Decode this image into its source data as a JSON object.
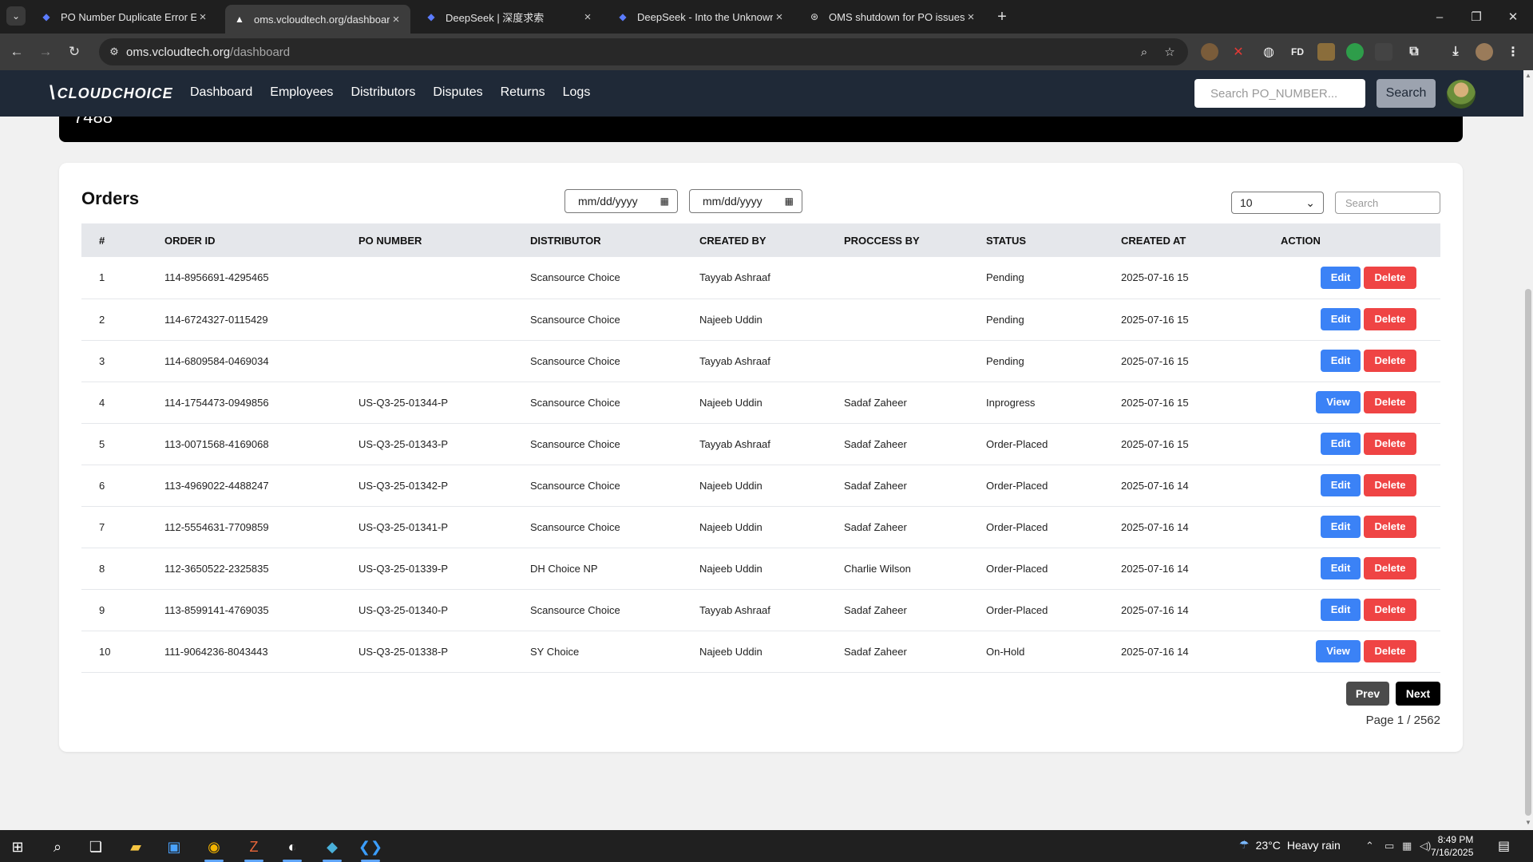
{
  "browser": {
    "tabs": [
      {
        "title": "PO Number Duplicate Error Exp",
        "icon": "deepseek-icon"
      },
      {
        "title": "oms.vcloudtech.org/dashboard",
        "icon": "site-icon"
      },
      {
        "title": "DeepSeek | 深度求索",
        "icon": "deepseek-icon"
      },
      {
        "title": "DeepSeek - Into the Unknown",
        "icon": "deepseek-icon"
      },
      {
        "title": "OMS shutdown for PO issues",
        "icon": "chatgpt-icon"
      }
    ],
    "url_host": "oms.vcloudtech.org",
    "url_path": "/dashboard"
  },
  "app": {
    "logo_text": "CLOUDCHOICE",
    "nav": [
      "Dashboard",
      "Employees",
      "Distributors",
      "Disputes",
      "Returns",
      "Logs"
    ],
    "search_placeholder": "Search PO_NUMBER...",
    "search_button": "Search"
  },
  "prev_card_value": "7488",
  "orders": {
    "title": "Orders",
    "date_from": "mm/dd/yyyy",
    "date_to": "mm/dd/yyyy",
    "page_size": "10",
    "search_placeholder": "Search",
    "columns": [
      "#",
      "ORDER ID",
      "PO NUMBER",
      "DISTRIBUTOR",
      "CREATED BY",
      "PROCCESS BY",
      "STATUS",
      "CREATED AT",
      "ACTION"
    ],
    "rows": [
      {
        "idx": "1",
        "order_id": "114-8956691-4295465",
        "po": "",
        "distributor": "Scansource Choice",
        "created_by": "Tayyab Ashraaf",
        "process_by": "",
        "status": "Pending",
        "created_at": "2025-07-16 15",
        "action": "Edit"
      },
      {
        "idx": "2",
        "order_id": "114-6724327-0115429",
        "po": "",
        "distributor": "Scansource Choice",
        "created_by": "Najeeb Uddin",
        "process_by": "",
        "status": "Pending",
        "created_at": "2025-07-16 15",
        "action": "Edit"
      },
      {
        "idx": "3",
        "order_id": "114-6809584-0469034",
        "po": "",
        "distributor": "Scansource Choice",
        "created_by": "Tayyab Ashraaf",
        "process_by": "",
        "status": "Pending",
        "created_at": "2025-07-16 15",
        "action": "Edit"
      },
      {
        "idx": "4",
        "order_id": "114-1754473-0949856",
        "po": "US-Q3-25-01344-P",
        "distributor": "Scansource Choice",
        "created_by": "Najeeb Uddin",
        "process_by": "Sadaf Zaheer",
        "status": "Inprogress",
        "created_at": "2025-07-16 15",
        "action": "View"
      },
      {
        "idx": "5",
        "order_id": "113-0071568-4169068",
        "po": "US-Q3-25-01343-P",
        "distributor": "Scansource Choice",
        "created_by": "Tayyab Ashraaf",
        "process_by": "Sadaf Zaheer",
        "status": "Order-Placed",
        "created_at": "2025-07-16 15",
        "action": "Edit"
      },
      {
        "idx": "6",
        "order_id": "113-4969022-4488247",
        "po": "US-Q3-25-01342-P",
        "distributor": "Scansource Choice",
        "created_by": "Najeeb Uddin",
        "process_by": "Sadaf Zaheer",
        "status": "Order-Placed",
        "created_at": "2025-07-16 14",
        "action": "Edit"
      },
      {
        "idx": "7",
        "order_id": "112-5554631-7709859",
        "po": "US-Q3-25-01341-P",
        "distributor": "Scansource Choice",
        "created_by": "Najeeb Uddin",
        "process_by": "Sadaf Zaheer",
        "status": "Order-Placed",
        "created_at": "2025-07-16 14",
        "action": "Edit"
      },
      {
        "idx": "8",
        "order_id": "112-3650522-2325835",
        "po": "US-Q3-25-01339-P",
        "distributor": "DH Choice NP",
        "created_by": "Najeeb Uddin",
        "process_by": "Charlie Wilson",
        "status": "Order-Placed",
        "created_at": "2025-07-16 14",
        "action": "Edit"
      },
      {
        "idx": "9",
        "order_id": "113-8599141-4769035",
        "po": "US-Q3-25-01340-P",
        "distributor": "Scansource Choice",
        "created_by": "Tayyab Ashraaf",
        "process_by": "Sadaf Zaheer",
        "status": "Order-Placed",
        "created_at": "2025-07-16 14",
        "action": "Edit"
      },
      {
        "idx": "10",
        "order_id": "111-9064236-8043443",
        "po": "US-Q3-25-01338-P",
        "distributor": "SY Choice",
        "created_by": "Najeeb Uddin",
        "process_by": "Sadaf Zaheer",
        "status": "On-Hold",
        "created_at": "2025-07-16 14",
        "action": "View"
      }
    ],
    "delete_label": "Delete",
    "prev_label": "Prev",
    "next_label": "Next",
    "page_info": "Page 1 / 2562"
  },
  "taskbar": {
    "weather_temp": "23°C",
    "weather_text": "Heavy rain",
    "time": "8:49 PM",
    "date": "7/16/2025"
  },
  "colors": {
    "nav_bg": "#1f2937",
    "edit_blue": "#3b82f6",
    "delete_red": "#ef4444",
    "header_row": "#e5e7eb"
  }
}
